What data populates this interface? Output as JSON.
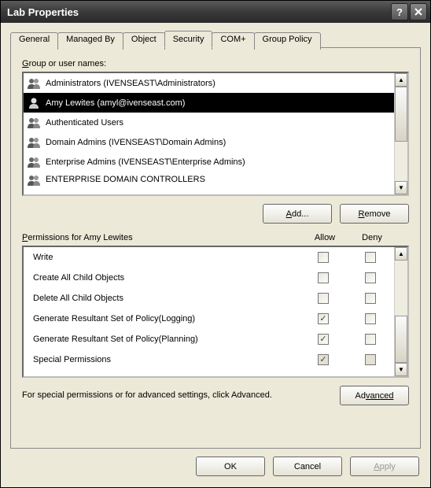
{
  "window": {
    "title": "Lab Properties"
  },
  "tabs": [
    {
      "label": "General"
    },
    {
      "label": "Managed By"
    },
    {
      "label": "Object"
    },
    {
      "label": "Security"
    },
    {
      "label": "COM+"
    },
    {
      "label": "Group Policy"
    }
  ],
  "labels": {
    "group_or_user": "roup or user names:",
    "group_prefix": "G",
    "permissions_for": "ermissions for Amy Lewites",
    "permissions_prefix": "P",
    "allow": "Allow",
    "deny": "Deny",
    "add": "dd...",
    "add_prefix": "A",
    "remove": "emove",
    "remove_prefix": "R",
    "advanced_hint": "For special permissions or for advanced settings, click Advanced.",
    "advanced": "vanced",
    "advanced_prefix": "Ad",
    "ok": "OK",
    "cancel": "Cancel",
    "apply": "pply",
    "apply_prefix": "A"
  },
  "groups": [
    {
      "name": "Administrators (IVENSEAST\\Administrators)"
    },
    {
      "name": "Amy Lewites (amyl@ivenseast.com)"
    },
    {
      "name": "Authenticated Users"
    },
    {
      "name": "Domain Admins (IVENSEAST\\Domain Admins)"
    },
    {
      "name": "Enterprise Admins (IVENSEAST\\Enterprise Admins)"
    },
    {
      "name": "ENTERPRISE DOMAIN CONTROLLERS"
    }
  ],
  "permissions": [
    {
      "name": "Write",
      "allow": false,
      "deny": false,
      "disabled": false
    },
    {
      "name": "Create All Child Objects",
      "allow": false,
      "deny": false,
      "disabled": false
    },
    {
      "name": "Delete All Child Objects",
      "allow": false,
      "deny": false,
      "disabled": false
    },
    {
      "name": "Generate Resultant Set of Policy(Logging)",
      "allow": true,
      "deny": false,
      "disabled": false
    },
    {
      "name": "Generate Resultant Set of Policy(Planning)",
      "allow": true,
      "deny": false,
      "disabled": false
    },
    {
      "name": "Special Permissions",
      "allow": true,
      "deny": false,
      "disabled": true
    }
  ]
}
